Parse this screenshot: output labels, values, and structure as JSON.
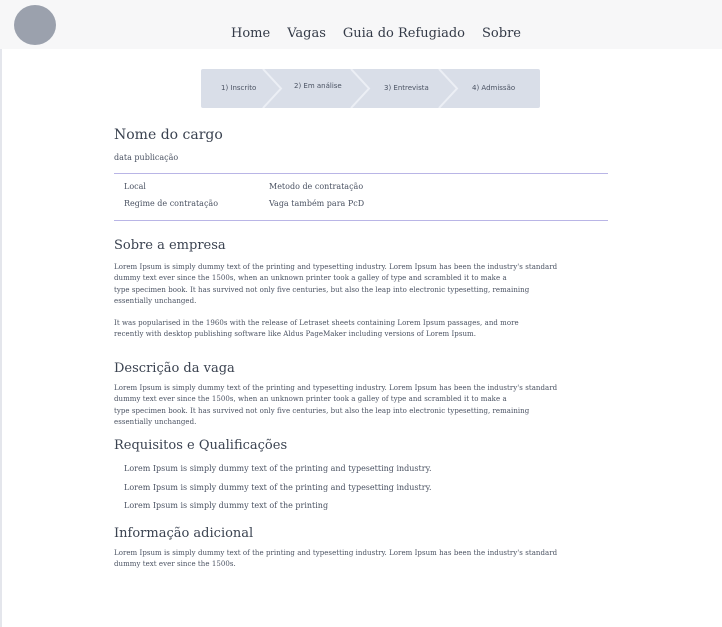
{
  "nav": {
    "items": [
      "Home",
      "Vagas",
      "Guia do Refugiado",
      "Sobre"
    ]
  },
  "stepper": {
    "steps": [
      "1) Inscrito",
      "2) Em análise",
      "3) Entrevista",
      "4) Admissão"
    ]
  },
  "job": {
    "title": "Nome do cargo",
    "published": "data publicação",
    "info": {
      "local": "Local",
      "regime": "Regime de contratação",
      "metodo": "Metodo de contratação",
      "pcd": "Vaga também para PcD"
    }
  },
  "sobre": {
    "heading": "Sobre a empresa",
    "p1_lines": [
      "Lorem Ipsum is simply dummy text of the printing and typesetting industry. Lorem Ipsum has been the industry's standard",
      "dummy text ever since the 1500s, when an unknown printer took a galley of type and scrambled it to make a",
      "type specimen book. It has survived not only five centuries, but also the leap into electronic typesetting, remaining",
      "essentially unchanged."
    ],
    "p2_lines": [
      "It was popularised in the 1960s with the release of Letraset sheets containing Lorem Ipsum passages, and more",
      "recently with desktop publishing software like Aldus PageMaker including versions of Lorem Ipsum."
    ]
  },
  "descricao": {
    "heading": "Descrição da vaga",
    "lines": [
      "Lorem Ipsum is simply dummy text of the printing and typesetting industry. Lorem Ipsum has been the industry's standard",
      "dummy text ever since the 1500s, when an unknown printer took a galley of type and scrambled it to make a",
      "type specimen book. It has survived not only five centuries, but also the leap into electronic typesetting, remaining",
      "essentially unchanged."
    ]
  },
  "requisitos": {
    "heading": "Requisitos e Qualificações",
    "items": [
      "Lorem Ipsum is simply dummy text of the printing and typesetting industry.",
      "Lorem Ipsum is simply dummy text of the printing and typesetting industry.",
      "Lorem Ipsum is simply dummy text of the printing"
    ]
  },
  "adicional": {
    "heading": "Informação adicional",
    "lines": [
      "Lorem Ipsum is simply dummy text of the printing and typesetting industry. Lorem Ipsum has been the industry's standard",
      "dummy text ever since the 1500s."
    ]
  },
  "colors": {
    "navbar_bg": "#f7f7f8",
    "avatar": "#9ba1ad",
    "stepper_bg": "#d9dee8",
    "divider": "#b9b5e6",
    "text": "#3a4250"
  },
  "icons": {
    "avatar": "user-avatar-icon"
  }
}
